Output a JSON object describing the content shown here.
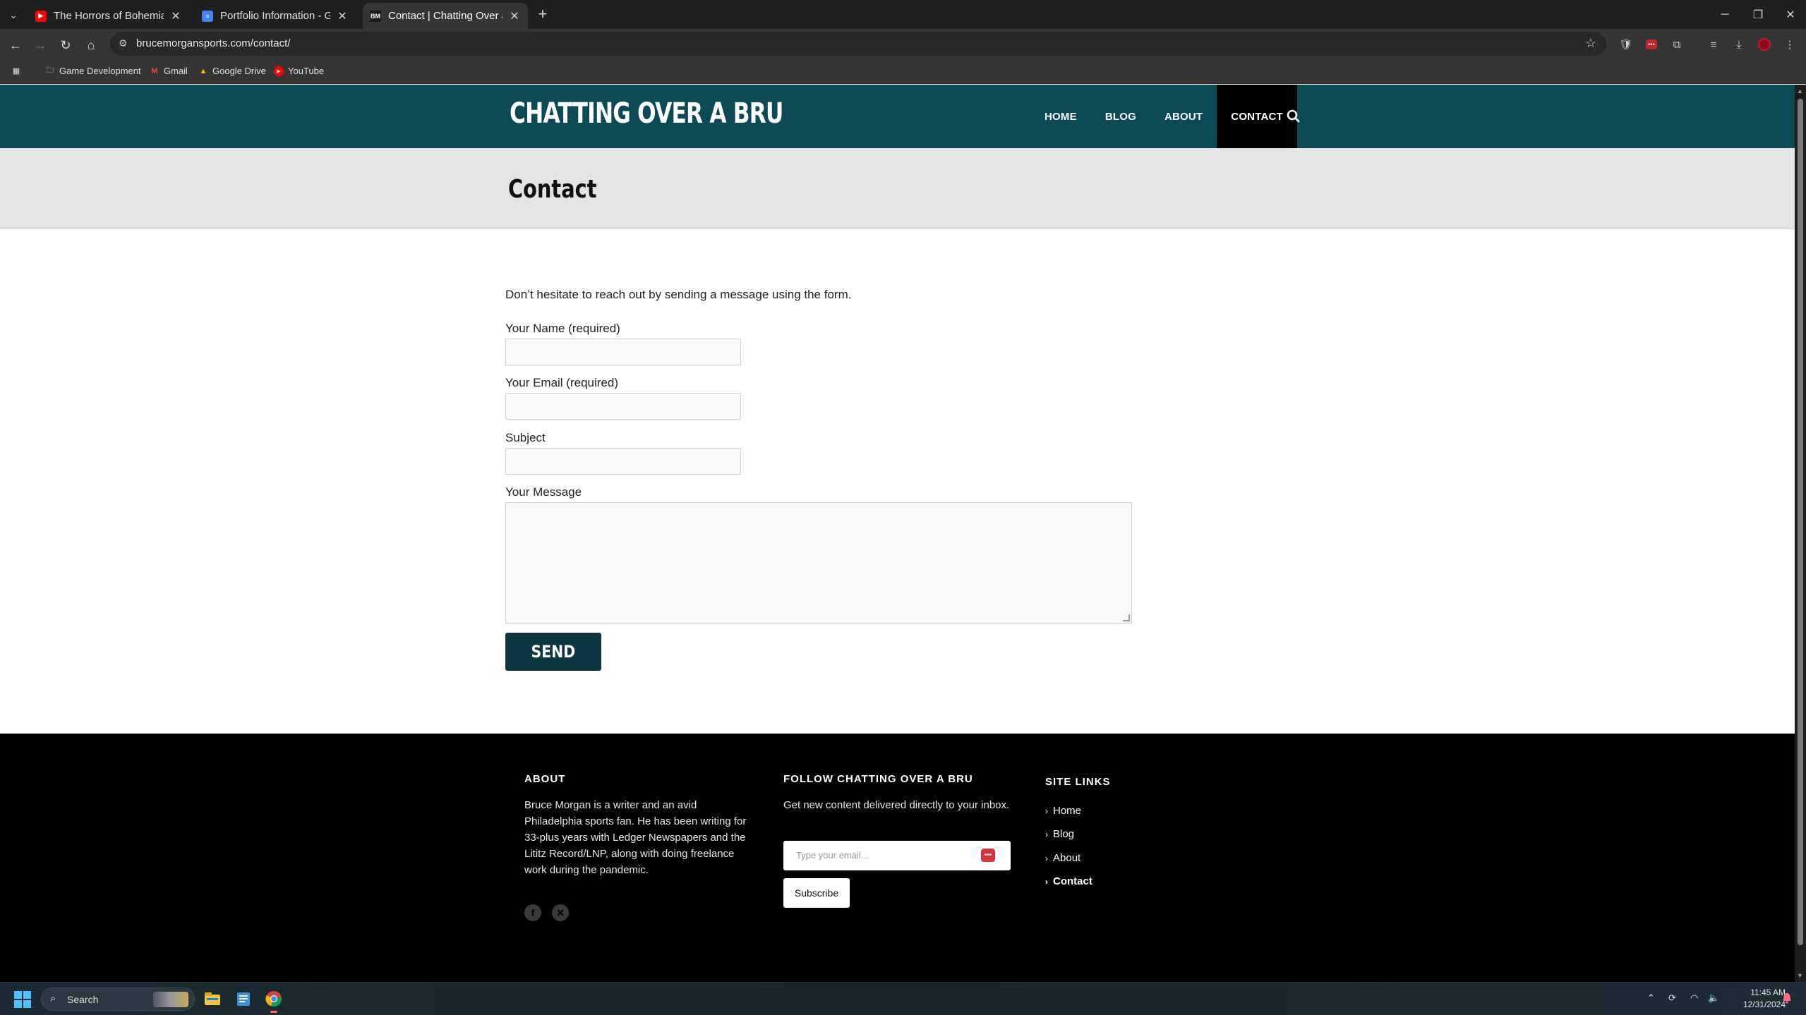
{
  "browser": {
    "tabs": [
      {
        "title": "The Horrors of Bohemian Grove",
        "favicon": "youtube-icon",
        "active": false
      },
      {
        "title": "Portfolio Information - Google",
        "favicon": "google-docs-icon",
        "active": false
      },
      {
        "title": "Contact | Chatting Over a Bru",
        "favicon": "BM",
        "active": true
      }
    ],
    "url": "brucemorgansports.com/contact/",
    "bookmarks": [
      {
        "label": "Game Development",
        "icon": "folder-icon"
      },
      {
        "label": "Gmail",
        "icon": "gmail-icon"
      },
      {
        "label": "Google Drive",
        "icon": "google-drive-icon"
      },
      {
        "label": "YouTube",
        "icon": "youtube-icon"
      }
    ]
  },
  "site": {
    "logo": "CHATTING OVER A BRU",
    "nav": [
      "HOME",
      "BLOG",
      "ABOUT",
      "CONTACT"
    ],
    "active_nav": "CONTACT",
    "header_color": "#0b4a55"
  },
  "page": {
    "title": "Contact",
    "intro": "Don’t hesitate to reach out by sending a message using the form.",
    "form": {
      "name_label": "Your Name (required)",
      "name_value": "",
      "email_label": "Your Email (required)",
      "email_value": "",
      "subject_label": "Subject",
      "subject_value": "",
      "message_label": "Your Message",
      "message_value": "",
      "send_label": "SEND"
    }
  },
  "footer": {
    "about_heading": "ABOUT",
    "about_text": "Bruce Morgan is a writer and an avid Philadelphia sports fan. He has been writing for 33-plus years with Ledger Newspapers and the Lititz Record/LNP, along with doing freelance work during the pandemic.",
    "social": [
      "facebook-icon",
      "x-icon"
    ],
    "follow_heading": "FOLLOW CHATTING OVER A BRU",
    "follow_text": "Get new content delivered directly to your inbox.",
    "email_placeholder": "Type your email…",
    "subscribe_label": "Subscribe",
    "links_heading": "SITE LINKS",
    "links": [
      "Home",
      "Blog",
      "About",
      "Contact"
    ],
    "current_link": "Contact"
  },
  "taskbar": {
    "search_label": "Search",
    "time": "11:45 AM",
    "date": "12/31/2024"
  }
}
